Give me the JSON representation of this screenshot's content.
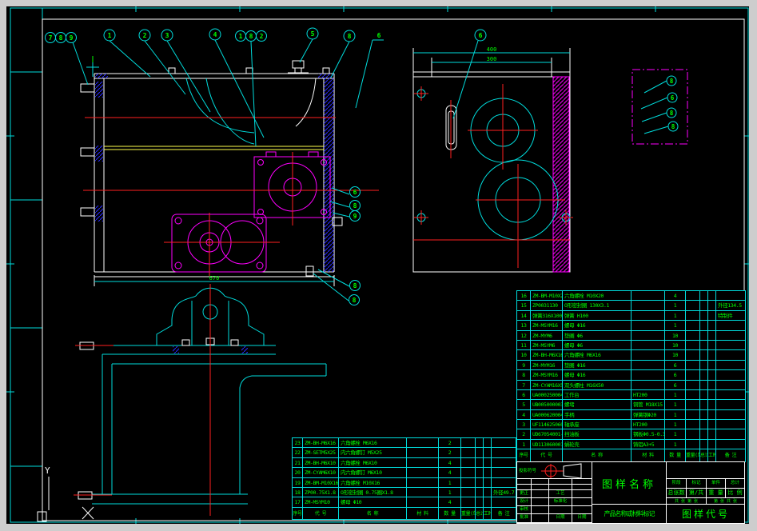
{
  "colors": {
    "background": "#000000",
    "line_cyan": "#00dcdc",
    "line_white": "#ffffff",
    "line_red": "#ff2020",
    "line_magenta": "#ff00ff",
    "line_blue": "#2a2aff",
    "line_yellow": "#ffff4d",
    "text_green": "#00ff00",
    "frame_gray": "#cdcdcd"
  },
  "dims": {
    "main_width": "670",
    "side_width": "400",
    "side_inner": "300"
  },
  "balloons": {
    "top_cluster": [
      "7",
      "8",
      "9"
    ],
    "b1": "1",
    "b2": "2",
    "b3": "3",
    "b4": "4",
    "mid_cluster": [
      "1",
      "8",
      "2"
    ],
    "b5": "5",
    "b8c": "8",
    "b6": "6",
    "right_stack": [
      "6",
      "8",
      "9"
    ],
    "right_lower": [
      "8",
      "8"
    ],
    "side_view": "6",
    "detail": [
      "8",
      "6",
      "8",
      "8"
    ]
  },
  "ucs": {
    "axis_label": "Y"
  },
  "bom_right": {
    "headers": [
      "序号",
      "代 号",
      "名 称",
      "材 料",
      "数 量",
      "重量(单件)",
      "总计",
      "工时",
      "备 注"
    ],
    "rows": [
      {
        "no": "16",
        "code": "ZM-BM-M10X20",
        "name": "六角螺栓  M10X20",
        "material": "",
        "qty": "4",
        "remark": ""
      },
      {
        "no": "15",
        "code": "ZP0031130",
        "name": "O形密封圈  130X3.1",
        "material": "",
        "qty": "1",
        "remark": "外径134.5"
      },
      {
        "no": "14",
        "code": "弹簧316X100",
        "name": "弹簧  H100",
        "material": "",
        "qty": "1",
        "remark": "特制件"
      },
      {
        "no": "13",
        "code": "ZM-MSYM16",
        "name": "螺母  Φ16",
        "material": "",
        "qty": "1",
        "remark": ""
      },
      {
        "no": "12",
        "code": "ZM-MYM6",
        "name": "垫圈  Φ6",
        "material": "",
        "qty": "10",
        "remark": ""
      },
      {
        "no": "11",
        "code": "ZM-MSYM6",
        "name": "螺母  Φ6",
        "material": "",
        "qty": "10",
        "remark": ""
      },
      {
        "no": "10",
        "code": "ZM-BH-M6X16",
        "name": "六角螺栓  M6X16",
        "material": "",
        "qty": "10",
        "remark": ""
      },
      {
        "no": "9",
        "code": "ZM-MYM16",
        "name": "垫圈  Φ16",
        "material": "",
        "qty": "6",
        "remark": ""
      },
      {
        "no": "8",
        "code": "ZM-MSYM16",
        "name": "螺母  Φ16",
        "material": "",
        "qty": "6",
        "remark": ""
      },
      {
        "no": "7",
        "code": "ZM-CYAM16X50",
        "name": "双头螺柱  M16X50",
        "material": "",
        "qty": "6",
        "remark": ""
      },
      {
        "no": "6",
        "code": "UA000250004-01",
        "name": "工作台",
        "material": "HT200",
        "qty": "1",
        "remark": ""
      },
      {
        "no": "5",
        "code": "UB005000003-01",
        "name": "螺堵",
        "material": "铜管 M18X15",
        "qty": "1",
        "remark": ""
      },
      {
        "no": "4",
        "code": "UA000620004-01",
        "name": "手柄",
        "material": "弹簧钢Φ20",
        "qty": "1",
        "remark": ""
      },
      {
        "no": "3",
        "code": "UF114625060-01",
        "name": "轴承座",
        "material": "HT200",
        "qty": "1",
        "remark": ""
      },
      {
        "no": "2",
        "code": "UD67054001-01",
        "name": "挡油板",
        "material": "钢板Φ0.5-0.3",
        "qty": "1",
        "remark": ""
      },
      {
        "no": "1",
        "code": "UD113060001-01",
        "name": "蜗轮壳",
        "material": "铸铝A3+5",
        "qty": "1",
        "remark": ""
      }
    ]
  },
  "bom_left": {
    "headers": [
      "序号",
      "代 号",
      "名 称",
      "材 料",
      "数 量",
      "重量(单件)",
      "总计",
      "工时",
      "备 注"
    ],
    "rows": [
      {
        "no": "23",
        "code": "ZM-BH-M6X16",
        "name": "六角螺栓  M6X16",
        "material": "",
        "qty": "2",
        "remark": ""
      },
      {
        "no": "22",
        "code": "ZM-SETM5X25",
        "name": "内六角螺钉  M5X25",
        "material": "",
        "qty": "2",
        "remark": ""
      },
      {
        "no": "21",
        "code": "ZM-BH-M6X10",
        "name": "六角螺栓  M6X10",
        "material": "",
        "qty": "4",
        "remark": ""
      },
      {
        "no": "20",
        "code": "ZM-CYAM6X10",
        "name": "内六角螺钉  M6X10",
        "material": "",
        "qty": "4",
        "remark": ""
      },
      {
        "no": "19",
        "code": "ZM-BM-M10X16",
        "name": "六角螺栓  M10X16",
        "material": "",
        "qty": "1",
        "remark": ""
      },
      {
        "no": "18",
        "code": "ZP00.75X1.8",
        "name": "O形密封圈  0.75圈X1.8",
        "material": "",
        "qty": "1",
        "remark": "外径49.7"
      },
      {
        "no": "17",
        "code": "ZM-MSYM10",
        "name": "螺母  Φ10",
        "material": "",
        "qty": "4",
        "remark": ""
      }
    ]
  },
  "title_block": {
    "projection_label": "投影符号",
    "grid_rows": [
      [
        "",
        "",
        "",
        ""
      ],
      [
        "",
        "",
        "",
        ""
      ],
      [
        "更正",
        "",
        "工艺",
        ""
      ],
      [
        "设计",
        "",
        "标准化",
        ""
      ],
      [
        "审核",
        "",
        "",
        ""
      ],
      [
        "批准",
        "",
        "日期",
        "日期"
      ]
    ],
    "drawing_name": "图样名称",
    "product_label": "产品名称或材料标记",
    "drawing_code": "图样代号",
    "info1": [
      "阶段",
      "标记",
      "单件",
      "总计"
    ],
    "info2": [
      "总张数",
      "第/共",
      "重 量",
      "比 例"
    ],
    "info3": [
      "共 张 第 张",
      "第 张 共 张"
    ]
  }
}
